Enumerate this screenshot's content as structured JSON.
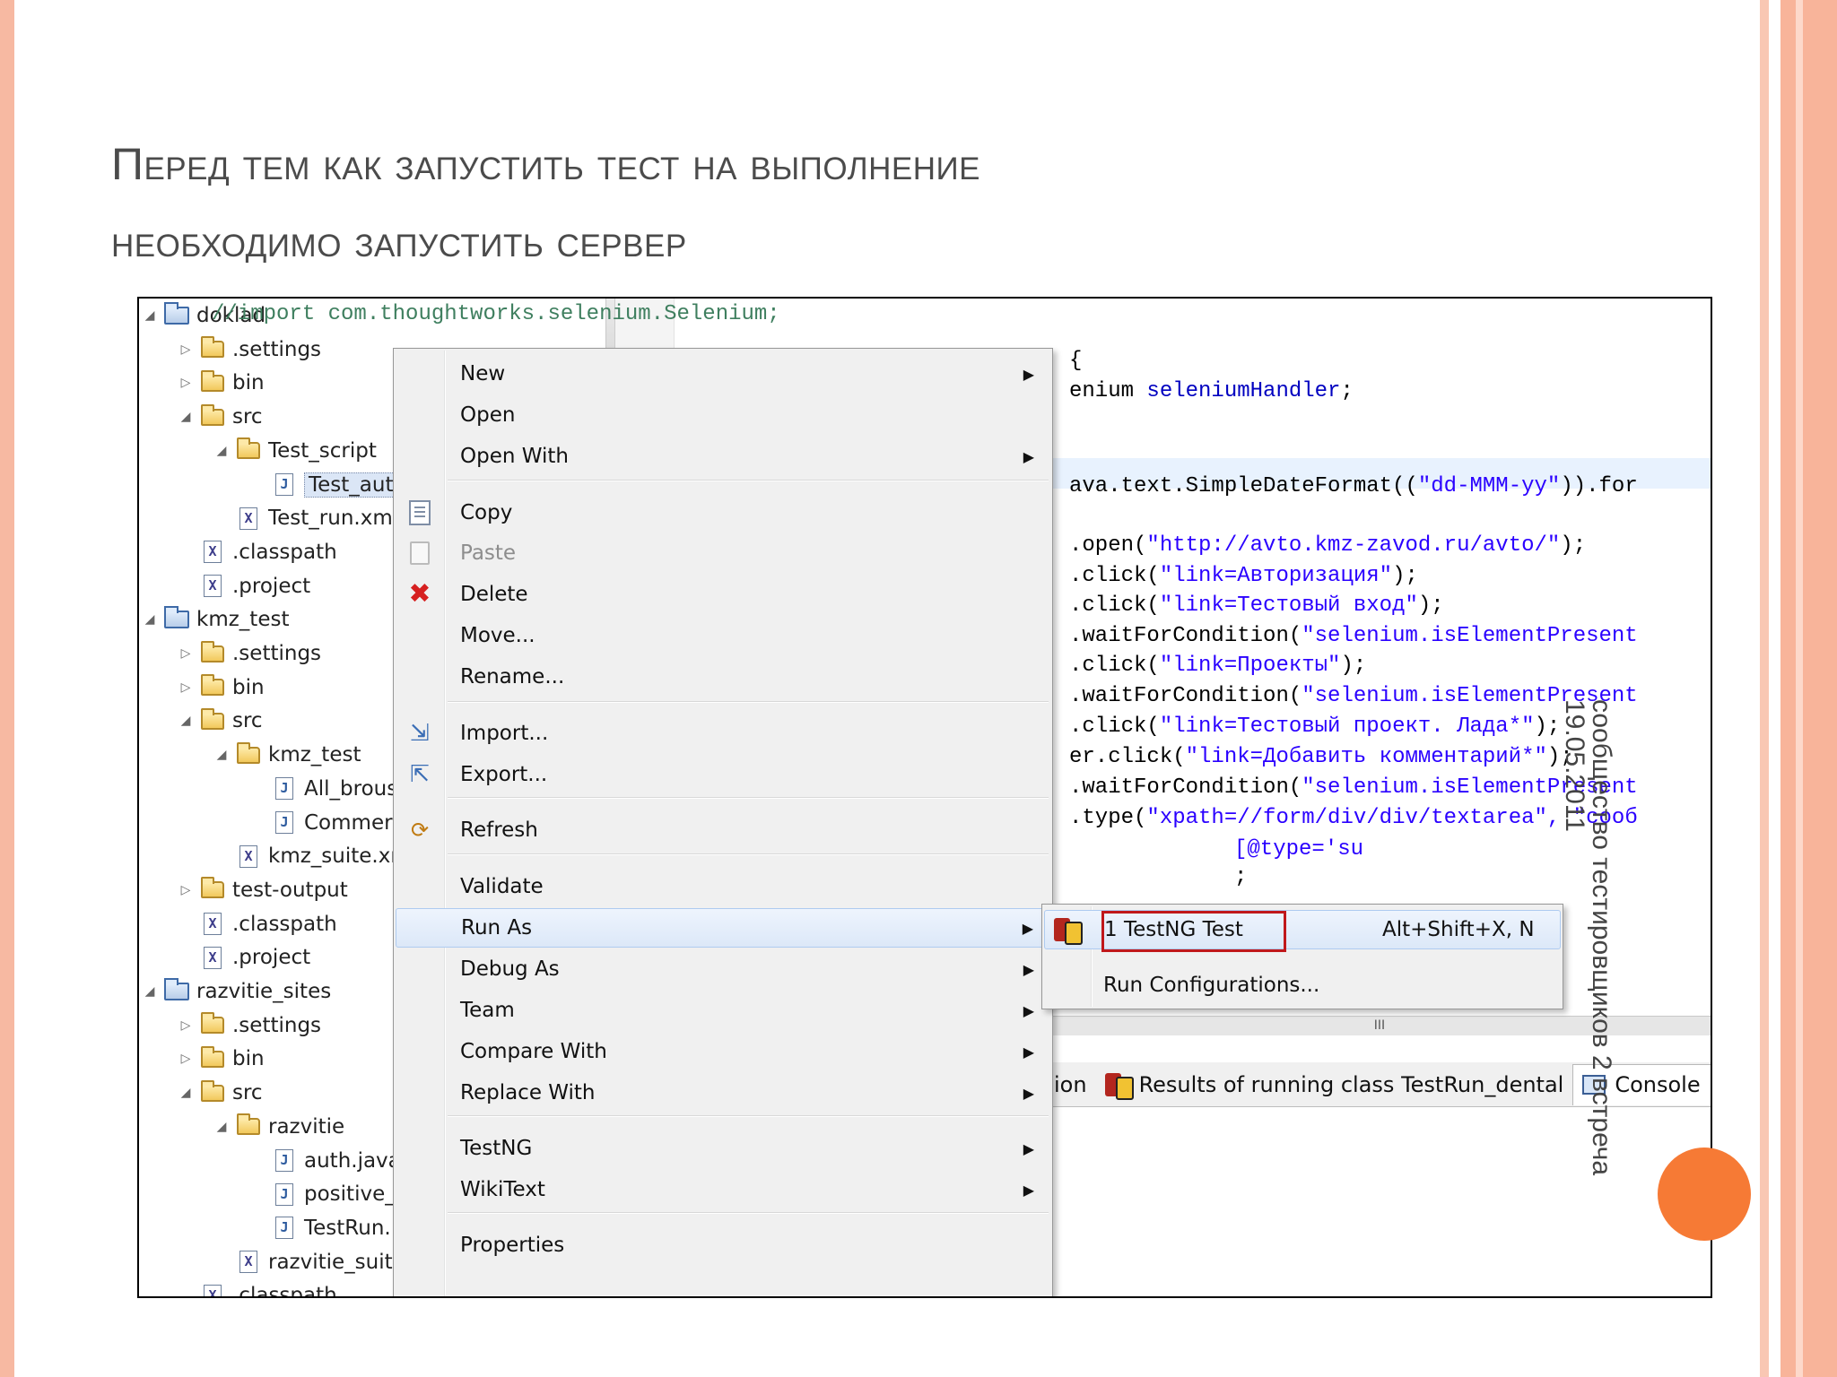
{
  "slide": {
    "title_line1": "Перед тем как запустить тест на выполнение",
    "title_line2": "необходимо запустить сервер",
    "side_text": "сообщество тестировщиков 2 встреча",
    "side_date": "19.05.2011"
  },
  "explorer": {
    "items": [
      {
        "label": "doklad",
        "icon": "project-icon",
        "twisty": "expanded"
      },
      {
        "label": ".settings",
        "icon": "folder-icon",
        "twisty": "collapsed"
      },
      {
        "label": "bin",
        "icon": "folder-icon",
        "twisty": "collapsed"
      },
      {
        "label": "src",
        "icon": "folder-icon",
        "twisty": "expanded"
      },
      {
        "label": "Test_script",
        "icon": "folder-icon",
        "twisty": "expanded"
      },
      {
        "label": "Test_auth",
        "icon": "java-file-icon",
        "twisty": "none"
      },
      {
        "label": "Test_run.xml",
        "icon": "xml-file-icon",
        "twisty": "none"
      },
      {
        "label": ".classpath",
        "icon": "xml-file-icon",
        "twisty": "none"
      },
      {
        "label": ".project",
        "icon": "xml-file-icon",
        "twisty": "none"
      },
      {
        "label": "kmz_test",
        "icon": "project-icon",
        "twisty": "expanded"
      },
      {
        "label": ".settings",
        "icon": "folder-icon",
        "twisty": "collapsed"
      },
      {
        "label": "bin",
        "icon": "folder-icon",
        "twisty": "collapsed"
      },
      {
        "label": "src",
        "icon": "folder-icon",
        "twisty": "expanded"
      },
      {
        "label": "kmz_test",
        "icon": "folder-icon",
        "twisty": "expanded"
      },
      {
        "label": "All_brous",
        "icon": "java-file-icon",
        "twisty": "none"
      },
      {
        "label": "Commer",
        "icon": "java-file-icon",
        "twisty": "none"
      },
      {
        "label": "kmz_suite.xn",
        "icon": "xml-file-icon",
        "twisty": "none"
      },
      {
        "label": "test-output",
        "icon": "folder-icon",
        "twisty": "collapsed"
      },
      {
        "label": ".classpath",
        "icon": "xml-file-icon",
        "twisty": "none"
      },
      {
        "label": ".project",
        "icon": "xml-file-icon",
        "twisty": "none"
      },
      {
        "label": "razvitie_sites",
        "icon": "project-icon",
        "twisty": "expanded"
      },
      {
        "label": ".settings",
        "icon": "folder-icon",
        "twisty": "collapsed"
      },
      {
        "label": "bin",
        "icon": "folder-icon",
        "twisty": "collapsed"
      },
      {
        "label": "src",
        "icon": "folder-icon",
        "twisty": "expanded"
      },
      {
        "label": "razvitie",
        "icon": "folder-icon",
        "twisty": "expanded"
      },
      {
        "label": "auth.java",
        "icon": "java-file-icon",
        "twisty": "none"
      },
      {
        "label": "positive_",
        "icon": "java-file-icon",
        "twisty": "none"
      },
      {
        "label": "TestRun.",
        "icon": "java-file-icon",
        "twisty": "none"
      },
      {
        "label": "razvitie_suite",
        "icon": "xml-file-icon",
        "twisty": "none"
      },
      {
        "label": ".classpath",
        "icon": "xml-file-icon",
        "twisty": "none"
      }
    ]
  },
  "editor": {
    "lines": [
      {
        "text": "//import com.thoughtworks.selenium.Selenium;",
        "kind": "comment"
      },
      {
        "text": "{",
        "kind": "plain"
      },
      {
        "text": "enium ",
        "kind": "plain",
        "rest": "seleniumHandler",
        "tail": ";"
      },
      {
        "text": "ava.text.SimpleDateFormat((",
        "kind": "plain",
        "rest": "\"dd-MMM-yy\"",
        "tail": ")).for"
      },
      {
        "text": ".open(",
        "kind": "plain",
        "rest": "\"http://avto.kmz-zavod.ru/avto/\"",
        "tail": ");"
      },
      {
        "text": ".click(",
        "kind": "plain",
        "rest": "\"link=Авторизация\"",
        "tail": ");"
      },
      {
        "text": ".click(",
        "kind": "plain",
        "rest": "\"link=Тестовый вход\"",
        "tail": ");"
      },
      {
        "text": ".waitForCondition(",
        "kind": "plain",
        "rest": "\"selenium.isElementPresent",
        "tail": ""
      },
      {
        "text": ".click(",
        "kind": "plain",
        "rest": "\"link=Проекты\"",
        "tail": ");"
      },
      {
        "text": ".waitForCondition(",
        "kind": "plain",
        "rest": "\"selenium.isElementPresent",
        "tail": ""
      },
      {
        "text": ".click(",
        "kind": "plain",
        "rest": "\"link=Тестовый проект. Лада*\"",
        "tail": ");"
      },
      {
        "text": "er.click(",
        "kind": "plain",
        "rest": "\"link=Добавить комментарий*\"",
        "tail": ");"
      },
      {
        "text": ".waitForCondition(",
        "kind": "plain",
        "rest": "\"selenium.isElementPresent",
        "tail": ""
      },
      {
        "text": ".type(",
        "kind": "plain",
        "rest": "\"xpath=//form/div/div/textarea\"",
        "tail": ", \"сооб"
      },
      {
        "text": "[@type='su",
        "kind": "string"
      },
      {
        "text": ";",
        "kind": "plain"
      }
    ],
    "scroll_marker": "III"
  },
  "bottom_tabs": [
    {
      "label": "ion",
      "icon": "none"
    },
    {
      "label": "Results of running class TestRun_dental",
      "icon": "testng-icon"
    },
    {
      "label": "Console",
      "icon": "console-icon",
      "close": "☒"
    }
  ],
  "context_menu": {
    "items": [
      {
        "label": "New",
        "arrow": "▶"
      },
      {
        "label": "Open"
      },
      {
        "label": "Open With",
        "arrow": "▶"
      },
      {
        "label": "Copy",
        "icon": "copy-icon"
      },
      {
        "label": "Paste",
        "icon": "paste-icon",
        "disabled": true
      },
      {
        "label": "Delete",
        "icon": "delete-icon"
      },
      {
        "label": "Move..."
      },
      {
        "label": "Rename..."
      },
      {
        "label": "Import...",
        "icon": "import-icon"
      },
      {
        "label": "Export...",
        "icon": "export-icon"
      },
      {
        "label": "Refresh",
        "icon": "refresh-icon"
      },
      {
        "label": "Validate"
      },
      {
        "label": "Run As",
        "arrow": "▶",
        "highlighted": true
      },
      {
        "label": "Debug As",
        "arrow": "▶"
      },
      {
        "label": "Team",
        "arrow": "▶"
      },
      {
        "label": "Compare With",
        "arrow": "▶"
      },
      {
        "label": "Replace With",
        "arrow": "▶"
      },
      {
        "label": "TestNG",
        "arrow": "▶"
      },
      {
        "label": "WikiText",
        "arrow": "▶"
      },
      {
        "label": "Properties"
      }
    ]
  },
  "run_as_submenu": {
    "items": [
      {
        "label": "1 TestNG Test",
        "shortcut": "Alt+Shift+X, N",
        "icon": "testng-icon"
      },
      {
        "label": "Run Configurations..."
      }
    ]
  },
  "colors": {
    "accent_stripe": "#f8b49a",
    "highlight_box": "#c0181b",
    "title_text": "#4b4b4b"
  }
}
